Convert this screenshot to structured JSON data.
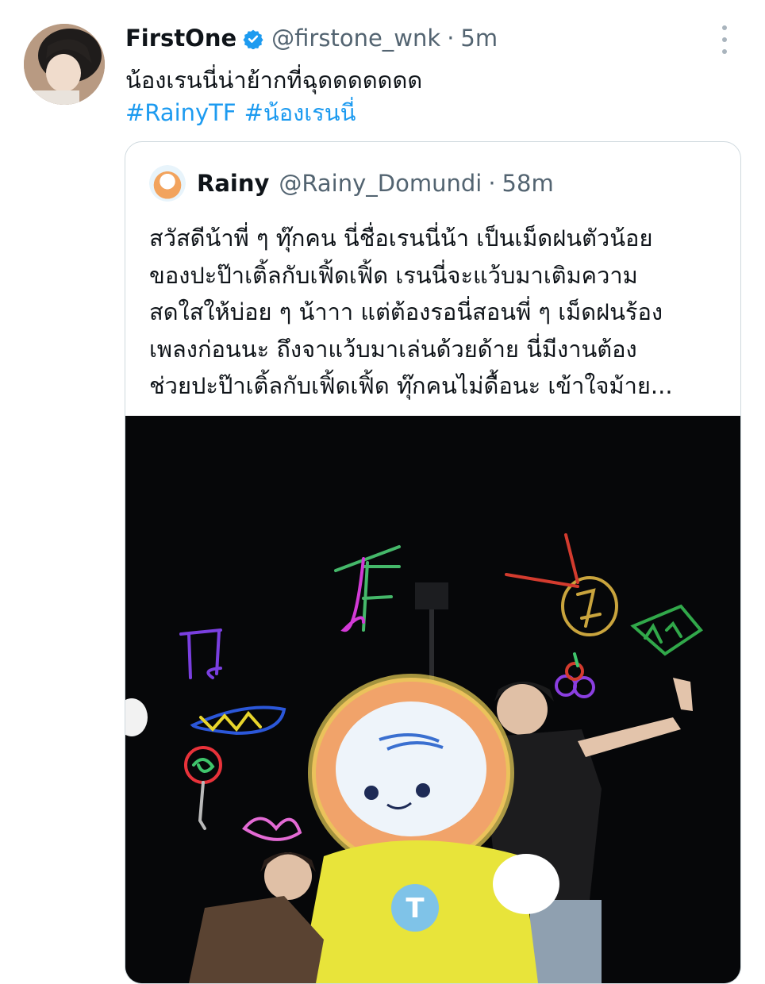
{
  "tweet": {
    "author_name": "FirstOne",
    "author_handle": "@firstone_wnk",
    "separator": "·",
    "time": "5m",
    "text": "น้องเรนนี่น่าย้ากที่ฉุดดดดดดด",
    "hashtags": [
      "#RainyTF",
      "#น้องเรนนี่"
    ],
    "icons": {
      "avatar": "user-avatar",
      "verified": "verified-badge-icon",
      "more": "more-options-icon"
    },
    "colors": {
      "link": "#1d9bf0",
      "secondary": "#536471",
      "verified": "#1d9bf0"
    }
  },
  "quoted": {
    "author_name": "Rainy",
    "author_handle": "@Rainy_Domundi",
    "separator": "·",
    "time": "58m",
    "lines": [
      "สวัสดีน้าพี่ ๆ ทุ๊กคน นี่ชื่อเรนนี่น้า เป็นเม็ดฝนตัวน้อย",
      "ของปะป๊าเติ้ลกับเฟิ้ดเฟิ้ด เรนนี่จะแว้บมาเติมความ",
      "สดใสให้บ่อย ๆ น้าาา แต่ต้องรอนี่สอนพี่ ๆ เม็ดฝนร้อง",
      "เพลงก่อนนะ ถึงจาแว้บมาเล่นด้วยด้าย นี่มีงานต้อง",
      "ช่วยปะป๊าเติ้ลกับเฟิ้ดเฟิ้ด ทุ๊กคนไม่ดื้อนะ เข้าใจม้าย..."
    ],
    "media": {
      "type": "photo",
      "content": "concert-stage-photo-mascot-two-people"
    },
    "mascot_badge": "T"
  }
}
